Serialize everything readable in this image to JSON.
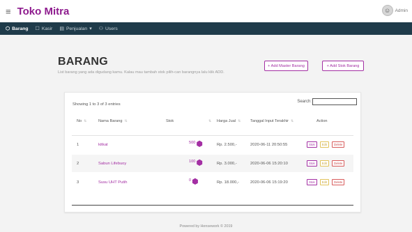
{
  "app": {
    "title": "Toko Mitra",
    "menu_icon": "hamburger-icon"
  },
  "user": {
    "name": "Admin",
    "avatar_icon": "user-avatar-icon"
  },
  "nav": [
    {
      "label": "Barang",
      "icon": "cube-icon",
      "glyph": "⬡",
      "active": true
    },
    {
      "label": "Kasir",
      "icon": "monitor-icon",
      "glyph": "☐",
      "active": false
    },
    {
      "label": "Penjualan",
      "icon": "document-icon",
      "glyph": "▤",
      "active": false,
      "caret": "▾"
    },
    {
      "label": "Users",
      "icon": "user-icon",
      "glyph": "⚇",
      "active": false
    }
  ],
  "page": {
    "title": "BARANG",
    "subtitle": "List barang yang ada digudang kamu. Kalau mau tambah stok pilih-can barangnya lalu klik ADD."
  },
  "buttons": {
    "add_master": "+ Add Master Barang",
    "add_stok": "+ Add Stok Barang"
  },
  "table": {
    "showing": "Showing 1 to 3 of 3 entries",
    "search_label": "Search:",
    "search_value": "",
    "columns": [
      "No",
      "Nama Barang",
      "Stok",
      "Harga Jual",
      "Tanggal Input Terakhir",
      "Action"
    ],
    "rows": [
      {
        "no": "1",
        "name": "kitkat",
        "stock": "500",
        "price": "Rp. 2.500,-",
        "date": "2020-06-11 20:50:55"
      },
      {
        "no": "2",
        "name": "Sabun Lifebuoy",
        "stock": "100",
        "price": "Rp. 3.000,-",
        "date": "2020-06-06 15:20:10"
      },
      {
        "no": "3",
        "name": "Susu UHT Putih",
        "stock": "0",
        "price": "Rp. 18.000,-",
        "date": "2020-06-06 15:19:20"
      }
    ],
    "actions": {
      "stok": "Stok",
      "edit": "Edit",
      "delete": "Delete"
    }
  },
  "footer": "Powered by Hensework © 2019",
  "colors": {
    "brand": "#8e1b8e",
    "nav_bg": "#1f3b4a",
    "accent": "#a32ea3"
  }
}
